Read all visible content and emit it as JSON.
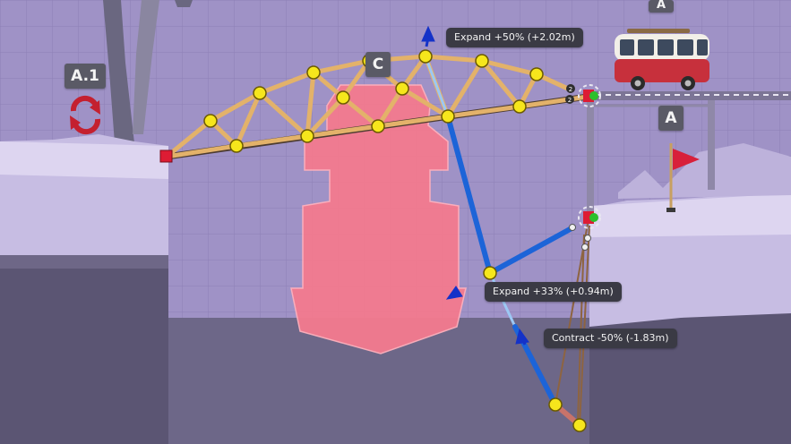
{
  "colors": {
    "sky": "#9f92c6",
    "ground": "#c7bde3",
    "dark_ground": "#5b5573",
    "water": "#6d6788",
    "ship": "#f47a8f",
    "road": "#4c3b30",
    "wood": "#e3b26a",
    "hydraulic": "#1c64d8",
    "joint": "#f6e61c",
    "anchor": "#dd1c34",
    "rope": "#8e6440"
  },
  "zones": {
    "start": "A.1",
    "ship": "C",
    "goal": "A",
    "vehicle_goal": "A"
  },
  "icons": {
    "checkpoint": "cycle-arrows-icon",
    "finish": "red-flag-icon",
    "vehicle": "camper-van-icon"
  },
  "hydraulics": [
    {
      "label": "Expand +50% (+2.02m)"
    },
    {
      "label": "Expand +33% (+0.94m)"
    },
    {
      "label": "Contract -50% (-1.83m)"
    }
  ],
  "joint_counters": [
    "2",
    "2"
  ]
}
